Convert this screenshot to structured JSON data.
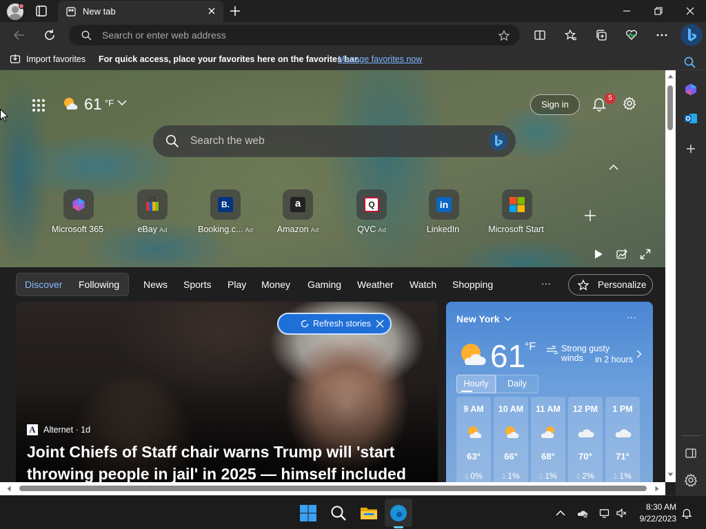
{
  "browser": {
    "tab_title": "New tab",
    "address_placeholder": "Search or enter web address",
    "favorites_bar": {
      "import_label": "Import favorites",
      "hint": "For quick access, place your favorites here on the favorites bar.",
      "manage_link": "Manage favorites now"
    }
  },
  "newtab": {
    "weather": {
      "temp": "61",
      "unit": "°F"
    },
    "sign_in_label": "Sign in",
    "notification_count": "5",
    "search_placeholder": "Search the web",
    "quick_links": [
      {
        "label": "Microsoft 365",
        "ad": ""
      },
      {
        "label": "eBay",
        "ad": "Ad"
      },
      {
        "label": "Booking.c...",
        "ad": "Ad"
      },
      {
        "label": "Amazon",
        "ad": "Ad"
      },
      {
        "label": "QVC",
        "ad": "Ad"
      },
      {
        "label": "LinkedIn",
        "ad": ""
      },
      {
        "label": "Microsoft Start",
        "ad": ""
      }
    ],
    "quick_link_glyphs": {
      "booking": "B.",
      "amazon": "a",
      "qvc": "Q",
      "linkedin": "in"
    }
  },
  "feed": {
    "nav": {
      "discover": "Discover",
      "following": "Following",
      "items": [
        "News",
        "Sports",
        "Play",
        "Money",
        "Gaming",
        "Weather",
        "Watch",
        "Shopping"
      ],
      "more": "···",
      "personalize": "Personalize"
    },
    "refresh_label": "Refresh stories",
    "hero": {
      "source_logo": "A",
      "source": "Alternet · 1d",
      "title": "Joint Chiefs of Staff chair warns Trump will 'start throwing people in jail' in 2025 — himself included"
    },
    "weather_card": {
      "city": "New York",
      "more": "···",
      "temp": "61",
      "unit": "°F",
      "alert_line1": "Strong gusty winds",
      "alert_line2": "in 2 hours",
      "tab_hourly": "Hourly",
      "tab_daily": "Daily",
      "hours": [
        {
          "time": "9 AM",
          "temp": "63°",
          "precip": "0%",
          "icon": "partly-sunny-icon"
        },
        {
          "time": "10 AM",
          "temp": "66°",
          "precip": "1%",
          "icon": "partly-sunny-icon"
        },
        {
          "time": "11 AM",
          "temp": "68°",
          "precip": "1%",
          "icon": "partly-cloudy-icon"
        },
        {
          "time": "12 PM",
          "temp": "70°",
          "precip": "2%",
          "icon": "cloudy-icon"
        },
        {
          "time": "1 PM",
          "temp": "71°",
          "precip": "1%",
          "icon": "cloudy-icon"
        }
      ]
    }
  },
  "taskbar": {
    "time": "8:30 AM",
    "date": "9/22/2023"
  },
  "colors": {
    "accent": "#1f6fd8",
    "link": "#7fb6ff",
    "weather_card": "#4a86d4",
    "badge": "#d13438"
  }
}
